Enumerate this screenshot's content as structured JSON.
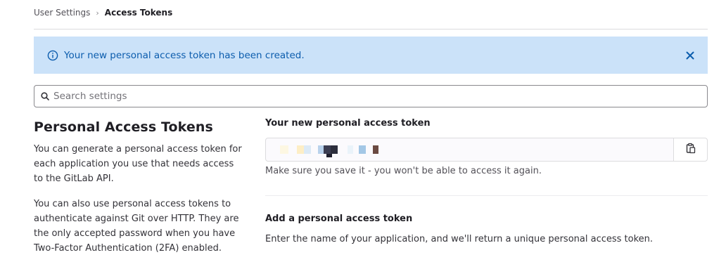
{
  "breadcrumb": {
    "parent": "User Settings",
    "separator": "›",
    "current": "Access Tokens"
  },
  "alert": {
    "message": "Your new personal access token has been created.",
    "icon": "info-icon",
    "close_icon": "close-icon",
    "background": "#cbe2f9",
    "text_color": "#0b5cad"
  },
  "search": {
    "placeholder": "Search settings",
    "value": ""
  },
  "section": {
    "title": "Personal Access Tokens",
    "paragraph_1": "You can generate a personal access token for each application you use that needs access to the GitLab API.",
    "paragraph_2": "You can also use personal access tokens to authenticate against Git over HTTP. They are the only accepted password when you have Two-Factor Authentication (2FA) enabled."
  },
  "new_token": {
    "label": "Your new personal access token",
    "copy_icon": "clipboard-icon",
    "help_text": "Make sure you save it - you won't be able to access it again."
  },
  "add_token": {
    "title": "Add a personal access token",
    "description": "Enter the name of your application, and we'll return a unique personal access token."
  }
}
